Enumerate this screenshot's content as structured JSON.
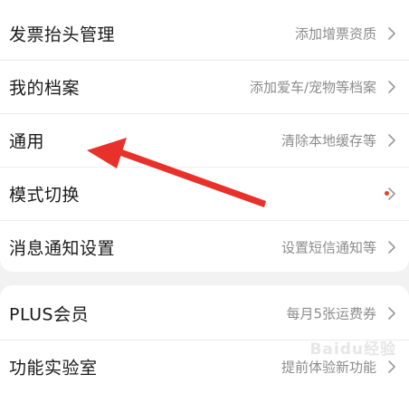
{
  "settings_group_1": [
    {
      "title": "发票抬头管理",
      "value": "添加增票资质"
    },
    {
      "title": "我的档案",
      "value": "添加爱车/宠物等档案"
    },
    {
      "title": "通用",
      "value": "清除本地缓存等"
    },
    {
      "title": "模式切换",
      "value": ""
    },
    {
      "title": "消息通知设置",
      "value": "设置短信通知等"
    }
  ],
  "settings_group_2": [
    {
      "title": "PLUS会员",
      "value": "每月5张运费券"
    },
    {
      "title": "功能实验室",
      "value": "提前体验新功能"
    }
  ],
  "annotation": {
    "arrow_color": "#e8312a",
    "points_to": "通用"
  },
  "watermark": "Baidu经验",
  "colors": {
    "background": "#f2f2f2",
    "card": "#ffffff",
    "title_text": "#1a1a1a",
    "value_text": "#8c8c8c",
    "red_dot": "#e0432f"
  }
}
